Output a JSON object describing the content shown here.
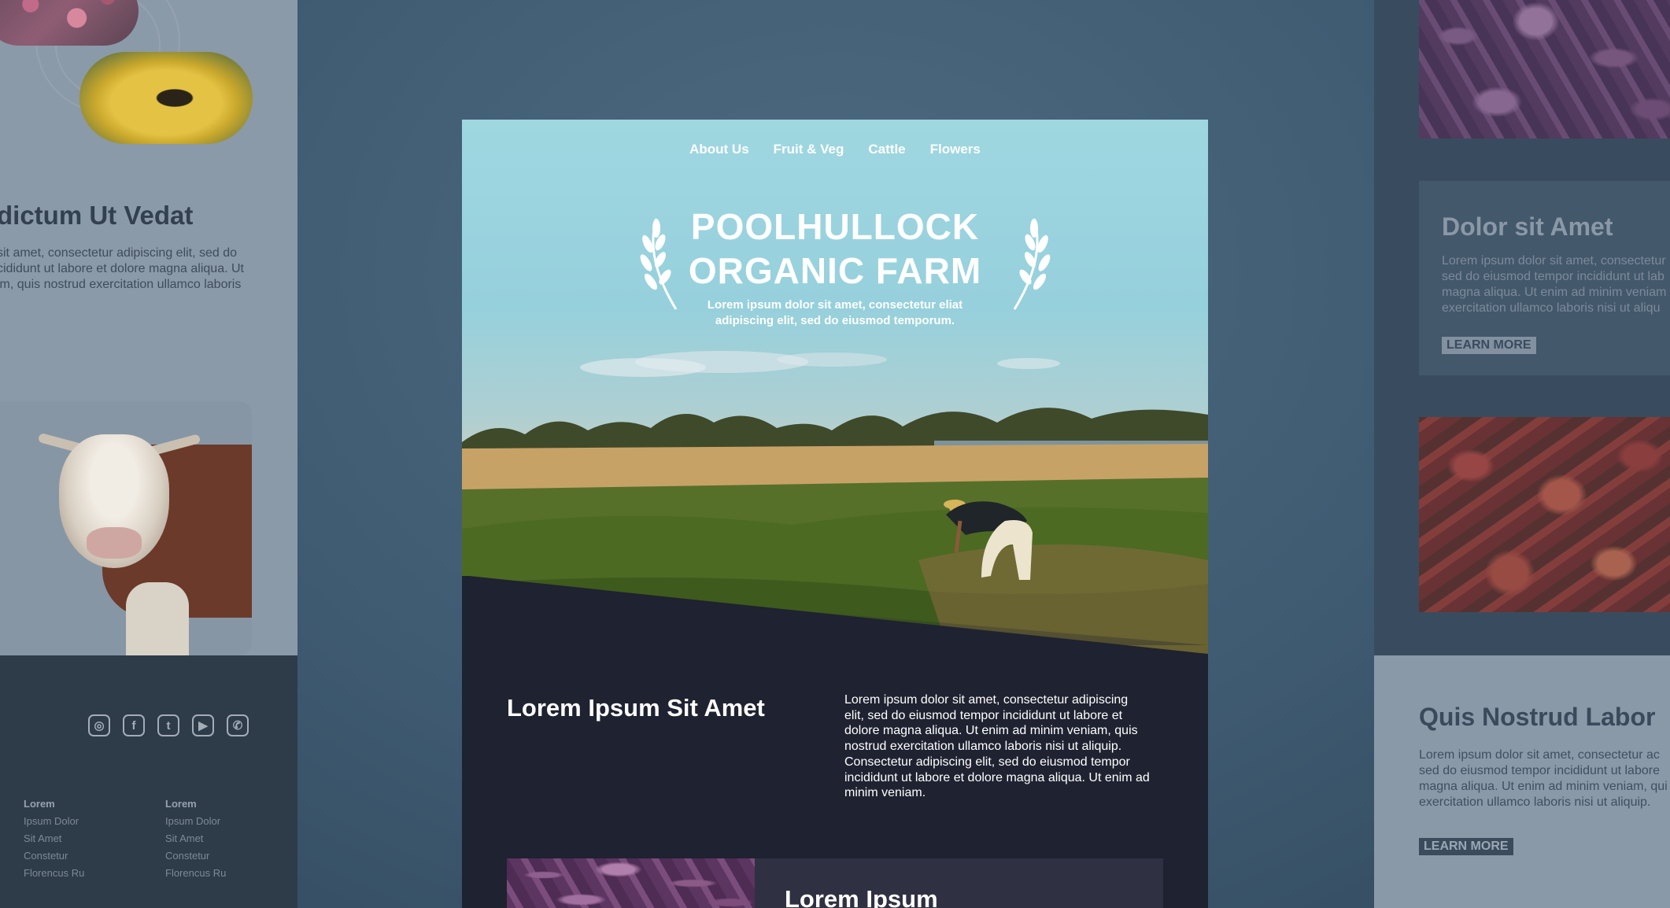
{
  "left_panel": {
    "heading": "dictum Ut Vedat",
    "paragraph_lines": [
      "sit amet, consectetur adipiscing elit, sed do",
      "cididunt ut labore et dolore magna aliqua. Ut",
      "im, quis nostrud exercitation ullamco laboris"
    ],
    "social_icons": [
      "instagram-icon",
      "facebook-icon",
      "twitter-icon",
      "youtube-icon",
      "whatsapp-icon"
    ],
    "footer_columns": [
      {
        "title": "Lorem",
        "items": [
          "Ipsum Dolor",
          "Sit Amet",
          "Constetur",
          "Florencus Ru"
        ]
      },
      {
        "title": "Lorem",
        "items": [
          "Ipsum Dolor",
          "Sit Amet",
          "Constetur",
          "Florencus Ru"
        ]
      }
    ]
  },
  "main": {
    "nav": [
      "About Us",
      "Fruit & Veg",
      "Cattle",
      "Flowers"
    ],
    "hero": {
      "title_line1": "POOLHULLOCK",
      "title_line2": "ORGANIC FARM",
      "subtitle_line1": "Lorem ipsum dolor sit amet, consectetur eliat",
      "subtitle_line2": "adipiscing elit, sed do eiusmod temporum."
    },
    "section": {
      "title": "Lorem Ipsum Sit Amet",
      "paragraph_lines": [
        "Lorem ipsum dolor sit amet, consectetur adipiscing",
        "elit, sed do eiusmod tempor incididunt ut labore et",
        "dolore magna aliqua. Ut enim ad minim veniam, quis",
        "nostrud exercitation ullamco laboris nisi ut aliquip.",
        "Consectetur adipiscing elit, sed do eiusmod tempor",
        "incididunt ut labore et dolore magna aliqua. Ut enim ad",
        "minim veniam."
      ]
    },
    "bottom_card_title": "Lorem Ipsum"
  },
  "right_panel": {
    "card1": {
      "title": "Dolor sit Amet",
      "paragraph_lines": [
        "Lorem ipsum dolor sit amet, consectetur",
        "sed do eiusmod tempor incididunt ut lab",
        "magna aliqua. Ut enim ad minim veniam",
        "exercitation ullamco laboris nisi ut aliqu"
      ],
      "button": "LEARN MORE"
    },
    "card2": {
      "title": "Quis Nostrud Labor",
      "paragraph_lines": [
        "Lorem ipsum dolor sit amet, consectetur ac",
        "sed do eiusmod tempor incididunt ut labore",
        "magna aliqua. Ut enim ad minim veniam, qui",
        "exercitation ullamco laboris nisi ut aliquip."
      ],
      "button": "LEARN MORE"
    }
  }
}
